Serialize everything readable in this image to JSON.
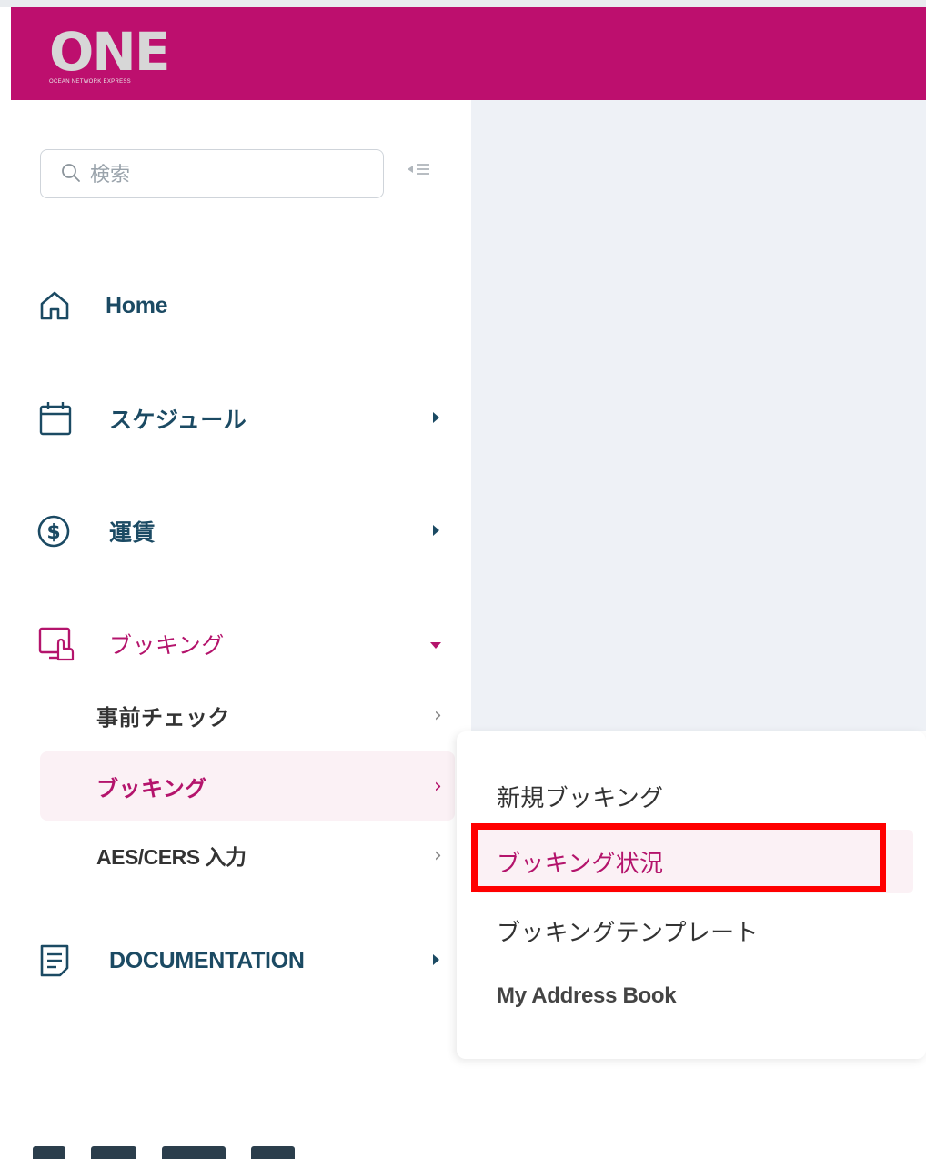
{
  "brand": {
    "name": "ONE",
    "tagline": "OCEAN NETWORK EXPRESS",
    "color": "#bd0f6e"
  },
  "search": {
    "placeholder": "検索"
  },
  "nav": [
    {
      "label": "Home",
      "icon": "home-icon"
    },
    {
      "label": "スケジュール",
      "icon": "calendar-icon"
    },
    {
      "label": "運賃",
      "icon": "dollar-icon"
    },
    {
      "label": "ブッキング",
      "icon": "booking-icon",
      "expanded": true
    },
    {
      "label": "DOCUMENTATION",
      "icon": "document-icon"
    }
  ],
  "booking_submenu": [
    {
      "label": "事前チェック"
    },
    {
      "label": "ブッキング",
      "active": true
    },
    {
      "label": "AES/CERS 入力"
    }
  ],
  "popup_menu": [
    {
      "label": "新規ブッキング"
    },
    {
      "label": "ブッキング状況",
      "active": true,
      "highlighted": true
    },
    {
      "label": "ブッキングテンプレート"
    },
    {
      "label": "My Address Book"
    }
  ],
  "colors": {
    "accent": "#b4146c",
    "nav_text": "#1b4a63",
    "highlight_box": "#ff0000"
  }
}
